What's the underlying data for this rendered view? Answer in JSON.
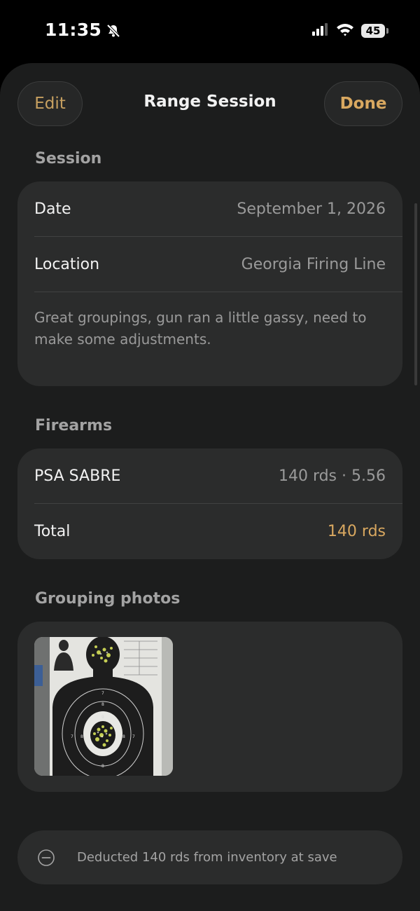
{
  "status_bar": {
    "time": "11:35",
    "battery": "45",
    "icons": [
      "bell-slash-icon",
      "signal-icon",
      "wifi-icon",
      "battery-icon"
    ]
  },
  "nav": {
    "edit_label": "Edit",
    "title": "Range Session",
    "done_label": "Done"
  },
  "session": {
    "header": "Session",
    "date_label": "Date",
    "date_value": "September 1, 2026",
    "location_label": "Location",
    "location_value": "Georgia Firing Line",
    "notes": "Great groupings, gun ran a little gassy, need to make some adjustments."
  },
  "firearms": {
    "header": "Firearms",
    "items": [
      {
        "name": "PSA SABRE",
        "detail": "140 rds · 5.56"
      }
    ],
    "total_label": "Total",
    "total_value": "140 rds"
  },
  "photos": {
    "header": "Grouping photos"
  },
  "banner": {
    "icon": "minus-circle-icon",
    "text": "Deducted 140 rds from inventory at save"
  },
  "colors": {
    "accent": "#d9a860",
    "background": "#1c1d1d",
    "card": "#2b2c2c"
  }
}
